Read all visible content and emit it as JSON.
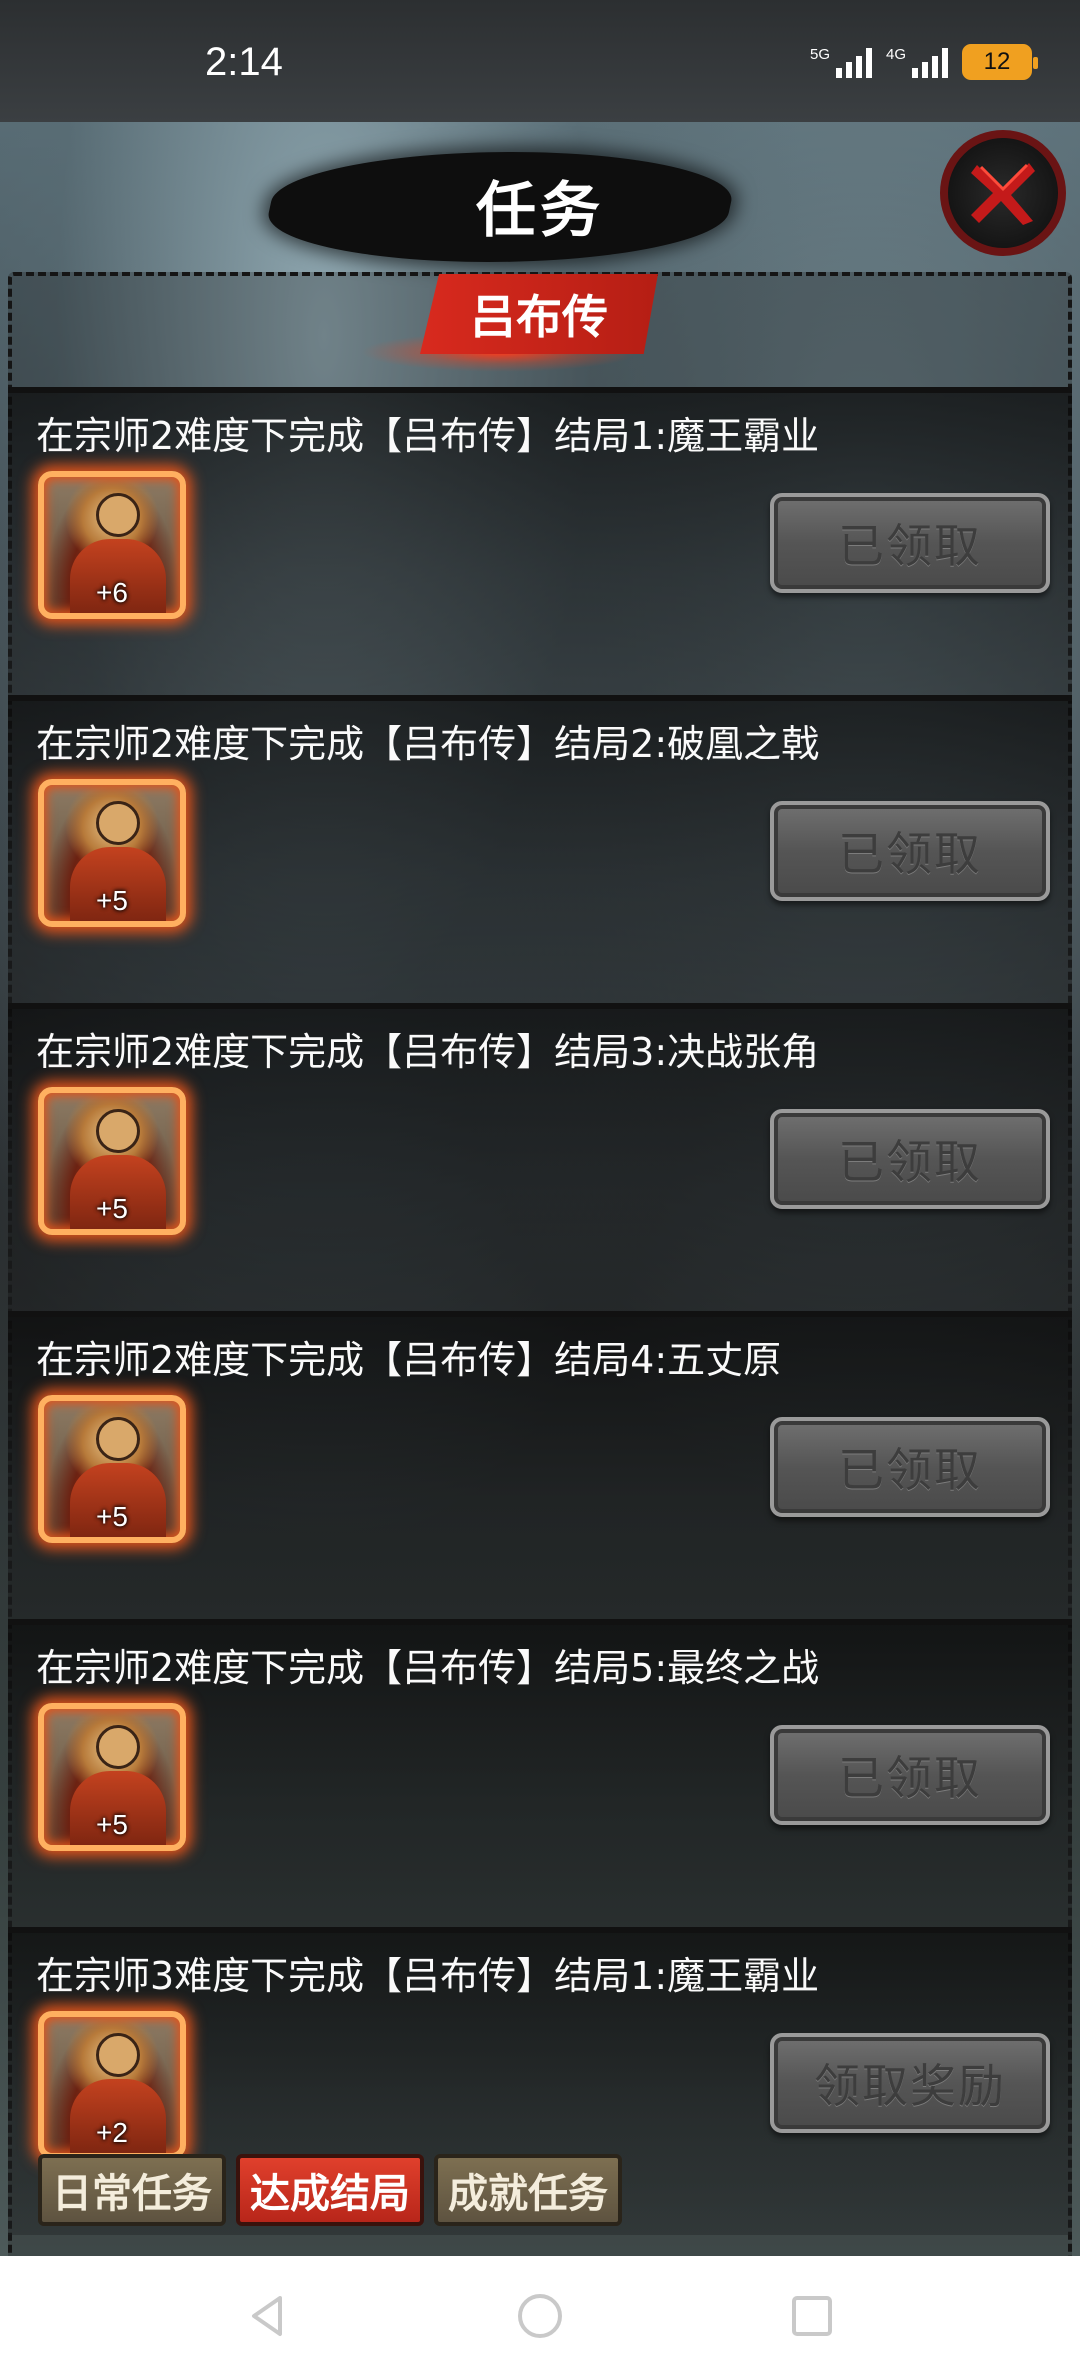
{
  "status_bar": {
    "time": "2:14",
    "signal_1_label": "5G",
    "signal_2_label": "4G",
    "battery": "12"
  },
  "header": {
    "title": "任务",
    "close_icon": "close-x-icon"
  },
  "section": {
    "banner": "吕布传"
  },
  "tasks": [
    {
      "description": "在宗师2难度下完成【吕布传】结局1:魔王霸业",
      "reward_amount": "+6",
      "button": "已领取",
      "claimed": true
    },
    {
      "description": "在宗师2难度下完成【吕布传】结局2:破凰之戟",
      "reward_amount": "+5",
      "button": "已领取",
      "claimed": true
    },
    {
      "description": "在宗师2难度下完成【吕布传】结局3:决战张角",
      "reward_amount": "+5",
      "button": "已领取",
      "claimed": true
    },
    {
      "description": "在宗师2难度下完成【吕布传】结局4:五丈原",
      "reward_amount": "+5",
      "button": "已领取",
      "claimed": true
    },
    {
      "description": "在宗师2难度下完成【吕布传】结局5:最终之战",
      "reward_amount": "+5",
      "button": "已领取",
      "claimed": true
    },
    {
      "description": "在宗师3难度下完成【吕布传】结局1:魔王霸业",
      "reward_amount": "+2",
      "button": "领取奖励",
      "claimed": false
    }
  ],
  "bottom_tabs": [
    {
      "label": "日常任务",
      "active": false
    },
    {
      "label": "达成结局",
      "active": true
    },
    {
      "label": "成就任务",
      "active": false
    }
  ],
  "nav_bar": {
    "back_icon": "back-triangle-icon",
    "home_icon": "home-circle-icon",
    "recents_icon": "recents-square-icon"
  },
  "colors": {
    "accent_red": "#d82a1e",
    "reward_glow": "#e0541c",
    "tab_bg": "#7d6f51"
  }
}
